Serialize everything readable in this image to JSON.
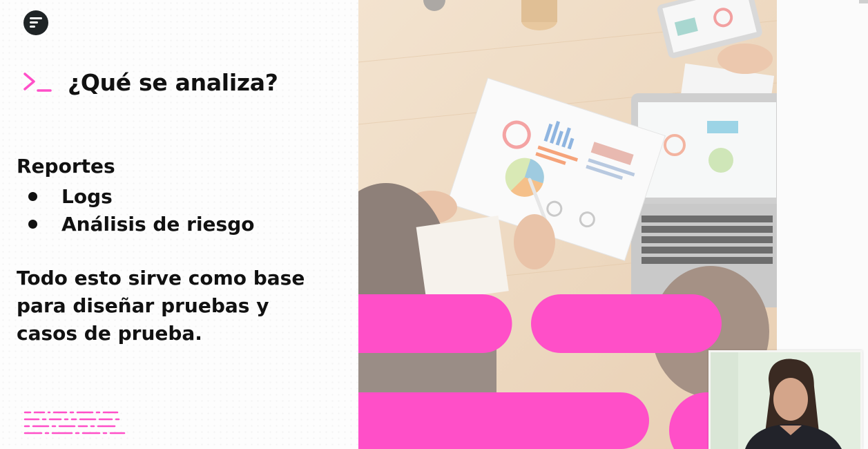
{
  "slide": {
    "heading": "¿Qué se analiza?",
    "section_label": "Reportes",
    "bullets": [
      "Logs",
      "Análisis de riesgo"
    ],
    "summary": "Todo esto sirve como base para diseñar pruebas y casos de prueba."
  },
  "icons": {
    "logo": "platform-logo-icon",
    "prompt": "terminal-prompt-icon"
  },
  "colors": {
    "accent_pink": "#ff4fc8",
    "text": "#111111",
    "logo_bg": "#1f2426"
  }
}
